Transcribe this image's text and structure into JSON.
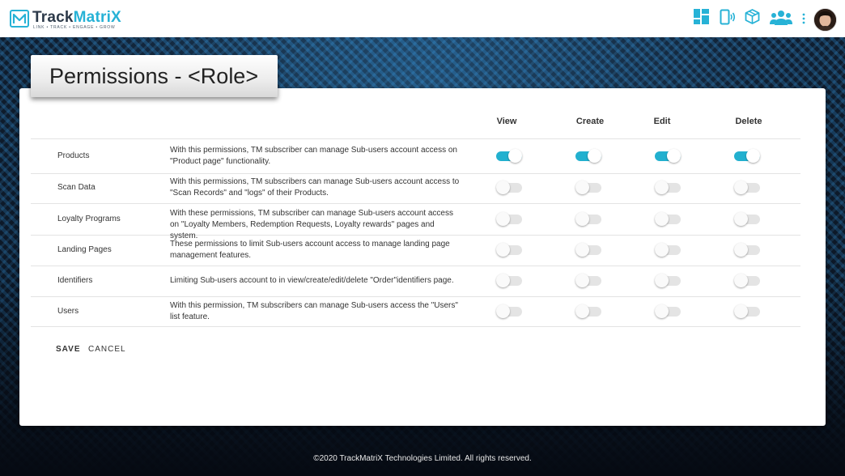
{
  "header": {
    "brand_name_part1": "Track",
    "brand_name_part2": "MatriX",
    "brand_tagline": "LINK • TRACK • ENGAGE • GROW",
    "icons": [
      "dashboard-icon",
      "mobile-scan-icon",
      "box-icon",
      "users-icon",
      "more-vert-icon"
    ],
    "accent_color": "#27b2d6"
  },
  "page": {
    "title": "Permissions - <Role>"
  },
  "columns": [
    "View",
    "Create",
    "Edit",
    "Delete"
  ],
  "rows": [
    {
      "name": "Products",
      "description": "With this permissions, TM subscriber can manage Sub-users account access on \"Product page\" functionality.",
      "view": true,
      "create": true,
      "edit": true,
      "delete": true
    },
    {
      "name": "Scan Data",
      "description": "With this permissions, TM subscribers can manage Sub-users account access to \"Scan Records\" and \"logs\" of their Products.",
      "view": false,
      "create": false,
      "edit": false,
      "delete": false
    },
    {
      "name": "Loyalty Programs",
      "description": "With these permissions, TM subscriber can manage Sub-users account access on \"Loyalty Members, Redemption Requests, Loyalty rewards\" pages and system.",
      "view": false,
      "create": false,
      "edit": false,
      "delete": false
    },
    {
      "name": "Landing Pages",
      "description": "These permissions to limit Sub-users account access to manage landing page management features.",
      "view": false,
      "create": false,
      "edit": false,
      "delete": false
    },
    {
      "name": "Identifiers",
      "description": "Limiting Sub-users account  to in view/create/edit/delete \"Order\"identifiers page.",
      "view": false,
      "create": false,
      "edit": false,
      "delete": false
    },
    {
      "name": "Users",
      "description": "With this permission, TM subscribers can manage Sub-users access the \"Users\" list feature.",
      "view": false,
      "create": false,
      "edit": false,
      "delete": false
    }
  ],
  "actions": {
    "save_label": "SAVE",
    "cancel_label": "CANCEL"
  },
  "footer": {
    "copyright": "©2020 TrackMatriX Technologies Limited. All rights reserved."
  }
}
